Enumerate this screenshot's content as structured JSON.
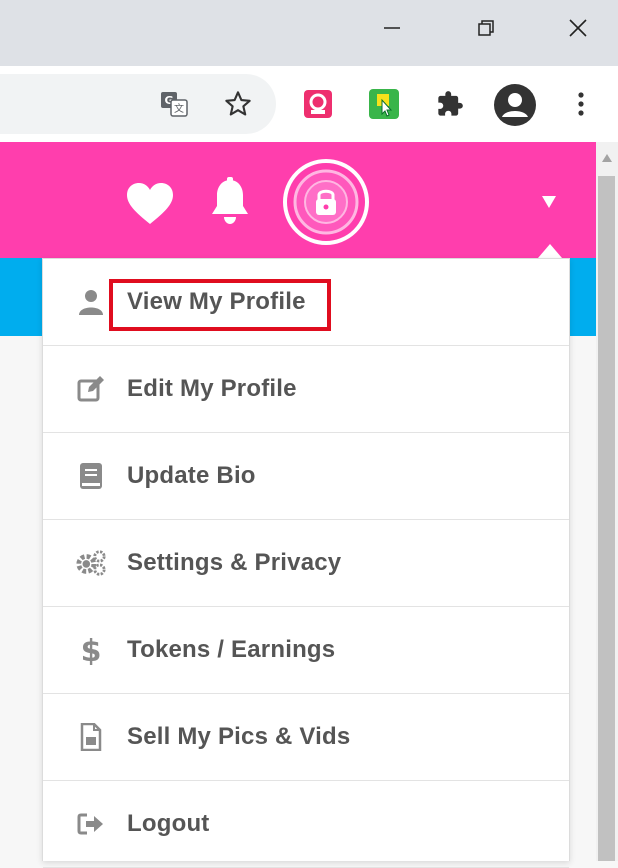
{
  "window": {
    "controls": [
      "minimize-icon",
      "restore-icon",
      "close-icon"
    ]
  },
  "browser": {
    "toolbar_icons": [
      "translate-icon",
      "star-icon",
      "extension-pink-icon",
      "extension-green-icon",
      "puzzle-icon",
      "profile-icon",
      "kebab-menu-icon"
    ]
  },
  "site": {
    "header_icons": [
      "heart-icon",
      "bell-icon",
      "lock-avatar-icon",
      "dropdown-caret-icon"
    ],
    "colors": {
      "header": "#ff3ead",
      "strip": "#00adee",
      "highlight": "#e00d1f"
    }
  },
  "menu": {
    "items": [
      {
        "label": "View My Profile",
        "icon": "user-icon"
      },
      {
        "label": "Edit My Profile",
        "icon": "edit-icon"
      },
      {
        "label": "Update Bio",
        "icon": "book-icon"
      },
      {
        "label": "Settings & Privacy",
        "icon": "cogs-icon"
      },
      {
        "label": "Tokens / Earnings",
        "icon": "dollar-icon"
      },
      {
        "label": "Sell My Pics & Vids",
        "icon": "file-icon"
      },
      {
        "label": "Logout",
        "icon": "sign-out-icon"
      }
    ]
  }
}
